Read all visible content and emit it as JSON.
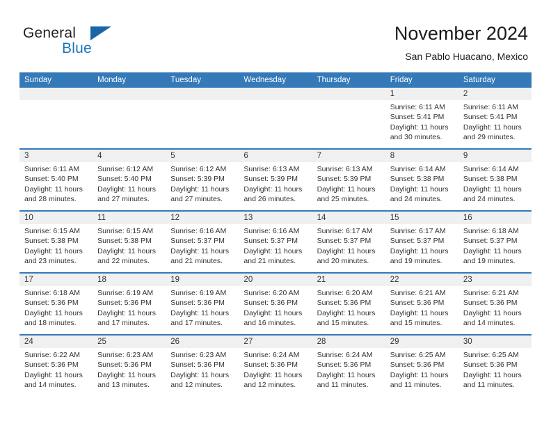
{
  "brand": {
    "name_part1": "General",
    "name_part2": "Blue",
    "flag_icon": "blue-triangle-flag-icon"
  },
  "header": {
    "title": "November 2024",
    "subtitle": "San Pablo Huacano, Mexico"
  },
  "colors": {
    "header_blue": "#3479b8",
    "brand_blue": "#1b75bb",
    "daynum_band": "#f0f0f0",
    "text": "#333333"
  },
  "weekdays": [
    "Sunday",
    "Monday",
    "Tuesday",
    "Wednesday",
    "Thursday",
    "Friday",
    "Saturday"
  ],
  "labels": {
    "sunrise_prefix": "Sunrise:",
    "sunset_prefix": "Sunset:",
    "daylight_prefix": "Daylight:"
  },
  "weeks": [
    [
      {
        "day": "",
        "sunrise": "",
        "sunset": "",
        "daylight_line1": "",
        "daylight_line2": "",
        "empty": true
      },
      {
        "day": "",
        "sunrise": "",
        "sunset": "",
        "daylight_line1": "",
        "daylight_line2": "",
        "empty": true
      },
      {
        "day": "",
        "sunrise": "",
        "sunset": "",
        "daylight_line1": "",
        "daylight_line2": "",
        "empty": true
      },
      {
        "day": "",
        "sunrise": "",
        "sunset": "",
        "daylight_line1": "",
        "daylight_line2": "",
        "empty": true
      },
      {
        "day": "",
        "sunrise": "",
        "sunset": "",
        "daylight_line1": "",
        "daylight_line2": "",
        "empty": true
      },
      {
        "day": "1",
        "sunrise": "Sunrise: 6:11 AM",
        "sunset": "Sunset: 5:41 PM",
        "daylight_line1": "Daylight: 11 hours",
        "daylight_line2": "and 30 minutes.",
        "empty": false
      },
      {
        "day": "2",
        "sunrise": "Sunrise: 6:11 AM",
        "sunset": "Sunset: 5:41 PM",
        "daylight_line1": "Daylight: 11 hours",
        "daylight_line2": "and 29 minutes.",
        "empty": false
      }
    ],
    [
      {
        "day": "3",
        "sunrise": "Sunrise: 6:11 AM",
        "sunset": "Sunset: 5:40 PM",
        "daylight_line1": "Daylight: 11 hours",
        "daylight_line2": "and 28 minutes.",
        "empty": false
      },
      {
        "day": "4",
        "sunrise": "Sunrise: 6:12 AM",
        "sunset": "Sunset: 5:40 PM",
        "daylight_line1": "Daylight: 11 hours",
        "daylight_line2": "and 27 minutes.",
        "empty": false
      },
      {
        "day": "5",
        "sunrise": "Sunrise: 6:12 AM",
        "sunset": "Sunset: 5:39 PM",
        "daylight_line1": "Daylight: 11 hours",
        "daylight_line2": "and 27 minutes.",
        "empty": false
      },
      {
        "day": "6",
        "sunrise": "Sunrise: 6:13 AM",
        "sunset": "Sunset: 5:39 PM",
        "daylight_line1": "Daylight: 11 hours",
        "daylight_line2": "and 26 minutes.",
        "empty": false
      },
      {
        "day": "7",
        "sunrise": "Sunrise: 6:13 AM",
        "sunset": "Sunset: 5:39 PM",
        "daylight_line1": "Daylight: 11 hours",
        "daylight_line2": "and 25 minutes.",
        "empty": false
      },
      {
        "day": "8",
        "sunrise": "Sunrise: 6:14 AM",
        "sunset": "Sunset: 5:38 PM",
        "daylight_line1": "Daylight: 11 hours",
        "daylight_line2": "and 24 minutes.",
        "empty": false
      },
      {
        "day": "9",
        "sunrise": "Sunrise: 6:14 AM",
        "sunset": "Sunset: 5:38 PM",
        "daylight_line1": "Daylight: 11 hours",
        "daylight_line2": "and 24 minutes.",
        "empty": false
      }
    ],
    [
      {
        "day": "10",
        "sunrise": "Sunrise: 6:15 AM",
        "sunset": "Sunset: 5:38 PM",
        "daylight_line1": "Daylight: 11 hours",
        "daylight_line2": "and 23 minutes.",
        "empty": false
      },
      {
        "day": "11",
        "sunrise": "Sunrise: 6:15 AM",
        "sunset": "Sunset: 5:38 PM",
        "daylight_line1": "Daylight: 11 hours",
        "daylight_line2": "and 22 minutes.",
        "empty": false
      },
      {
        "day": "12",
        "sunrise": "Sunrise: 6:16 AM",
        "sunset": "Sunset: 5:37 PM",
        "daylight_line1": "Daylight: 11 hours",
        "daylight_line2": "and 21 minutes.",
        "empty": false
      },
      {
        "day": "13",
        "sunrise": "Sunrise: 6:16 AM",
        "sunset": "Sunset: 5:37 PM",
        "daylight_line1": "Daylight: 11 hours",
        "daylight_line2": "and 21 minutes.",
        "empty": false
      },
      {
        "day": "14",
        "sunrise": "Sunrise: 6:17 AM",
        "sunset": "Sunset: 5:37 PM",
        "daylight_line1": "Daylight: 11 hours",
        "daylight_line2": "and 20 minutes.",
        "empty": false
      },
      {
        "day": "15",
        "sunrise": "Sunrise: 6:17 AM",
        "sunset": "Sunset: 5:37 PM",
        "daylight_line1": "Daylight: 11 hours",
        "daylight_line2": "and 19 minutes.",
        "empty": false
      },
      {
        "day": "16",
        "sunrise": "Sunrise: 6:18 AM",
        "sunset": "Sunset: 5:37 PM",
        "daylight_line1": "Daylight: 11 hours",
        "daylight_line2": "and 19 minutes.",
        "empty": false
      }
    ],
    [
      {
        "day": "17",
        "sunrise": "Sunrise: 6:18 AM",
        "sunset": "Sunset: 5:36 PM",
        "daylight_line1": "Daylight: 11 hours",
        "daylight_line2": "and 18 minutes.",
        "empty": false
      },
      {
        "day": "18",
        "sunrise": "Sunrise: 6:19 AM",
        "sunset": "Sunset: 5:36 PM",
        "daylight_line1": "Daylight: 11 hours",
        "daylight_line2": "and 17 minutes.",
        "empty": false
      },
      {
        "day": "19",
        "sunrise": "Sunrise: 6:19 AM",
        "sunset": "Sunset: 5:36 PM",
        "daylight_line1": "Daylight: 11 hours",
        "daylight_line2": "and 17 minutes.",
        "empty": false
      },
      {
        "day": "20",
        "sunrise": "Sunrise: 6:20 AM",
        "sunset": "Sunset: 5:36 PM",
        "daylight_line1": "Daylight: 11 hours",
        "daylight_line2": "and 16 minutes.",
        "empty": false
      },
      {
        "day": "21",
        "sunrise": "Sunrise: 6:20 AM",
        "sunset": "Sunset: 5:36 PM",
        "daylight_line1": "Daylight: 11 hours",
        "daylight_line2": "and 15 minutes.",
        "empty": false
      },
      {
        "day": "22",
        "sunrise": "Sunrise: 6:21 AM",
        "sunset": "Sunset: 5:36 PM",
        "daylight_line1": "Daylight: 11 hours",
        "daylight_line2": "and 15 minutes.",
        "empty": false
      },
      {
        "day": "23",
        "sunrise": "Sunrise: 6:21 AM",
        "sunset": "Sunset: 5:36 PM",
        "daylight_line1": "Daylight: 11 hours",
        "daylight_line2": "and 14 minutes.",
        "empty": false
      }
    ],
    [
      {
        "day": "24",
        "sunrise": "Sunrise: 6:22 AM",
        "sunset": "Sunset: 5:36 PM",
        "daylight_line1": "Daylight: 11 hours",
        "daylight_line2": "and 14 minutes.",
        "empty": false
      },
      {
        "day": "25",
        "sunrise": "Sunrise: 6:23 AM",
        "sunset": "Sunset: 5:36 PM",
        "daylight_line1": "Daylight: 11 hours",
        "daylight_line2": "and 13 minutes.",
        "empty": false
      },
      {
        "day": "26",
        "sunrise": "Sunrise: 6:23 AM",
        "sunset": "Sunset: 5:36 PM",
        "daylight_line1": "Daylight: 11 hours",
        "daylight_line2": "and 12 minutes.",
        "empty": false
      },
      {
        "day": "27",
        "sunrise": "Sunrise: 6:24 AM",
        "sunset": "Sunset: 5:36 PM",
        "daylight_line1": "Daylight: 11 hours",
        "daylight_line2": "and 12 minutes.",
        "empty": false
      },
      {
        "day": "28",
        "sunrise": "Sunrise: 6:24 AM",
        "sunset": "Sunset: 5:36 PM",
        "daylight_line1": "Daylight: 11 hours",
        "daylight_line2": "and 11 minutes.",
        "empty": false
      },
      {
        "day": "29",
        "sunrise": "Sunrise: 6:25 AM",
        "sunset": "Sunset: 5:36 PM",
        "daylight_line1": "Daylight: 11 hours",
        "daylight_line2": "and 11 minutes.",
        "empty": false
      },
      {
        "day": "30",
        "sunrise": "Sunrise: 6:25 AM",
        "sunset": "Sunset: 5:36 PM",
        "daylight_line1": "Daylight: 11 hours",
        "daylight_line2": "and 11 minutes.",
        "empty": false
      }
    ]
  ]
}
